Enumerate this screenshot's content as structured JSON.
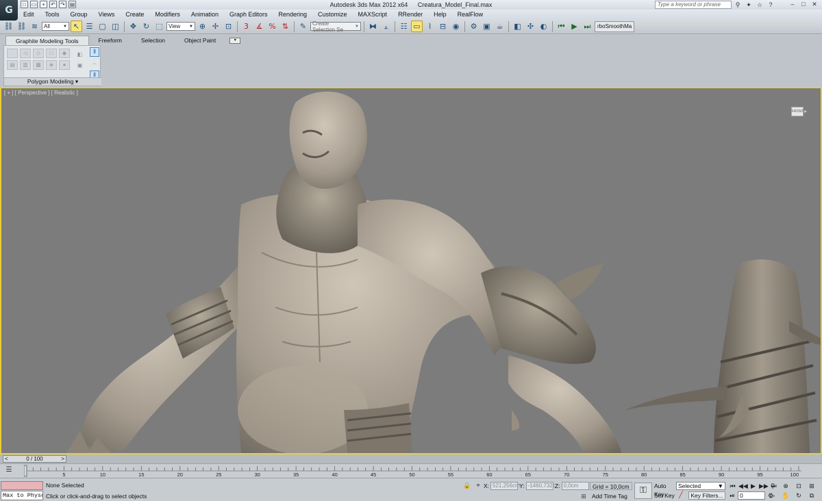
{
  "app": {
    "title": "Autodesk 3ds Max  2012 x64",
    "file": "Creatura_Model_Final.max",
    "search_placeholder": "Type a keyword or phrase",
    "logo_glyph": "G"
  },
  "menu": [
    "Edit",
    "Tools",
    "Group",
    "Views",
    "Create",
    "Modifiers",
    "Animation",
    "Graph Editors",
    "Rendering",
    "Customize",
    "MAXScript",
    "RRender",
    "Help",
    "RealFlow"
  ],
  "toolbar": {
    "filter_value": "All",
    "refcoord_value": "View",
    "selection_set_placeholder": "Create Selection Se",
    "script_button_label": "rboSmoothMa",
    "snap_labels": {
      "snap": "3",
      "angle": "",
      "percent": "%"
    }
  },
  "ribbon": {
    "tabs": [
      "Graphite Modeling Tools",
      "Freeform",
      "Selection",
      "Object Paint"
    ],
    "active_tab": 0,
    "panel_label": "Polygon Modeling"
  },
  "viewport": {
    "label": "[ + ] [ Perspective ] [ Realistic ]",
    "viewcube_label": "FRONT",
    "accent_color": "#e9cf35"
  },
  "timeline": {
    "slider_label": "0 / 100",
    "prev_arrow": "<",
    "next_arrow": ">",
    "ruler_ticks": [
      5,
      10,
      15,
      20,
      25,
      30,
      35,
      40,
      45,
      50,
      55,
      60,
      65,
      70,
      75,
      80,
      85,
      90,
      95,
      100
    ],
    "ruler_max": 100
  },
  "status": {
    "listener_text": "Max to Physc.",
    "selection_text": "None Selected",
    "prompt_text": "Click or click-and-drag to select objects",
    "x_label": "X:",
    "x_value": "521,256cm",
    "y_label": "Y:",
    "y_value": "-1460,732c",
    "z_label": "Z:",
    "z_value": "0,0cm",
    "grid_text": "Grid = 10,0cm",
    "time_tag": "Add Time Tag",
    "autokey_label": "Auto Key",
    "setkey_label": "Set Key",
    "key_select_value": "Selected",
    "key_filters_label": "Key Filters...",
    "frame_value": "0"
  }
}
